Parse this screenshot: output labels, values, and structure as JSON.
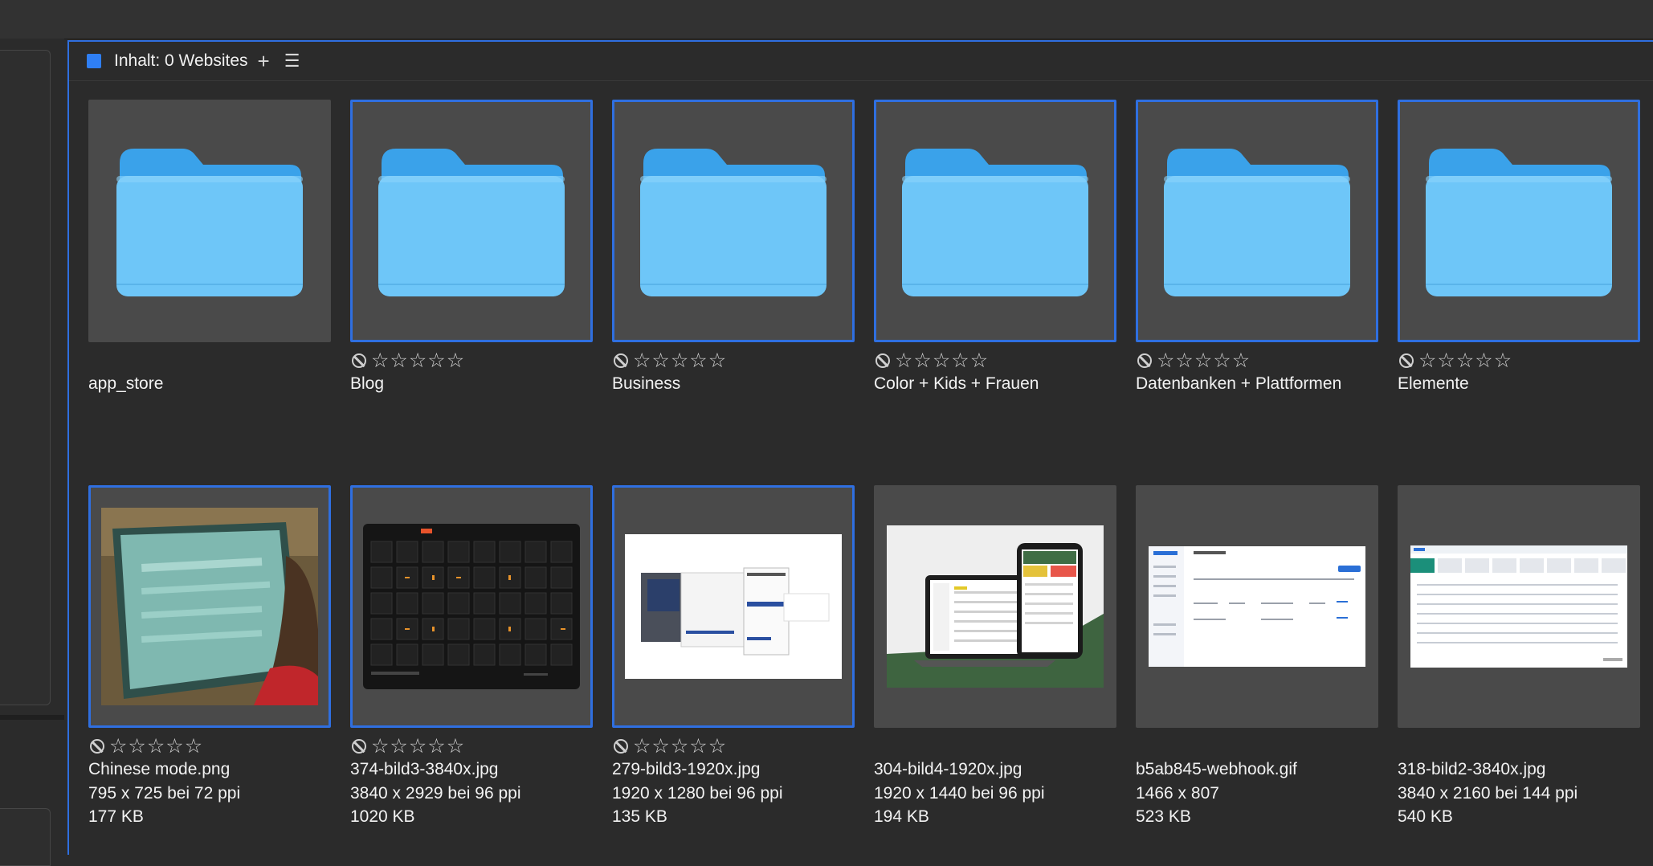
{
  "panel": {
    "title": "Inhalt: 0 Websites",
    "add_icon": "plus-icon",
    "menu_icon": "list-menu-icon",
    "accent_color": "#2f7ff5"
  },
  "folders": [
    {
      "name": "app_store",
      "selected": false,
      "rated": false
    },
    {
      "name": "Blog",
      "selected": true,
      "rated": true
    },
    {
      "name": "Business",
      "selected": true,
      "rated": true
    },
    {
      "name": "Color + Kids + Frauen",
      "selected": true,
      "rated": true
    },
    {
      "name": "Datenbanken + Plattformen",
      "selected": true,
      "rated": true
    },
    {
      "name": "Elemente",
      "selected": true,
      "rated": true
    }
  ],
  "files": [
    {
      "name": "Chinese mode.png",
      "dims": "795 x 725 bei 72 ppi",
      "size": "177 KB",
      "selected": true,
      "rated": true
    },
    {
      "name": "374-bild3-3840x.jpg",
      "dims": "3840 x 2929 bei 96 ppi",
      "size": "1020 KB",
      "selected": true,
      "rated": true
    },
    {
      "name": "279-bild3-1920x.jpg",
      "dims": "1920 x 1280 bei 96 ppi",
      "size": "135 KB",
      "selected": true,
      "rated": true
    },
    {
      "name": "304-bild4-1920x.jpg",
      "dims": "1920 x 1440 bei 96 ppi",
      "size": "194 KB",
      "selected": false,
      "rated": false
    },
    {
      "name": "b5ab845-webhook.gif",
      "dims": "1466 x 807",
      "size": "523 KB",
      "selected": false,
      "rated": false
    },
    {
      "name": "318-bild2-3840x.jpg",
      "dims": "3840 x 2160 bei 144 ppi",
      "size": "540 KB",
      "selected": false,
      "rated": false
    }
  ],
  "colors": {
    "selection": "#2f6fe0",
    "folder_front": "#6ec6f8",
    "folder_back": "#3aa2ea",
    "tile_bg": "#4a4a4a"
  }
}
